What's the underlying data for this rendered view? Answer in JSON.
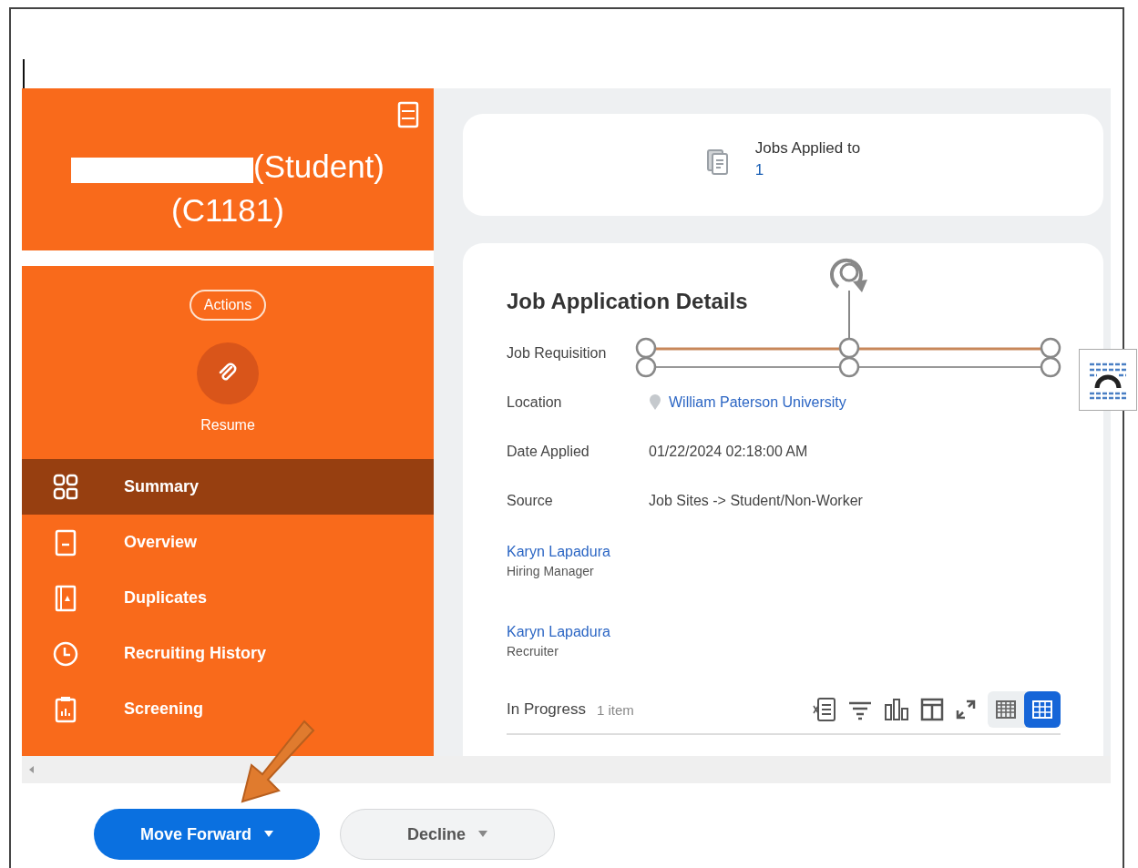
{
  "profile": {
    "name_suffix": "(Student)",
    "id": "(C1181)",
    "actions_label": "Actions",
    "resume_label": "Resume"
  },
  "nav": [
    {
      "label": "Summary",
      "selected": true
    },
    {
      "label": "Overview",
      "selected": false
    },
    {
      "label": "Duplicates",
      "selected": false
    },
    {
      "label": "Recruiting History",
      "selected": false
    },
    {
      "label": "Screening",
      "selected": false
    }
  ],
  "jobs_applied": {
    "label": "Jobs Applied to",
    "count": "1"
  },
  "details": {
    "title": "Job Application Details",
    "fields": [
      {
        "label": "Job Requisition",
        "kind": "object"
      },
      {
        "label": "Location",
        "kind": "location",
        "value": "William Paterson University"
      },
      {
        "label": "Date Applied",
        "kind": "text",
        "value": "01/22/2024 02:18:00 AM"
      },
      {
        "label": "Source",
        "kind": "text",
        "value": "Job Sites -> Student/Non-Worker"
      }
    ],
    "people": [
      {
        "name": "Karyn Lapadura",
        "role": "Hiring Manager"
      },
      {
        "name": "Karyn Lapadura",
        "role": "Recruiter"
      }
    ],
    "in_progress": {
      "label": "In Progress",
      "count": "1 item"
    },
    "view_toggle": [
      {
        "selected": false
      },
      {
        "selected": true
      }
    ]
  },
  "actions": [
    {
      "label": "Move Forward",
      "kind": "primary"
    },
    {
      "label": "Decline",
      "kind": "secondary"
    }
  ]
}
